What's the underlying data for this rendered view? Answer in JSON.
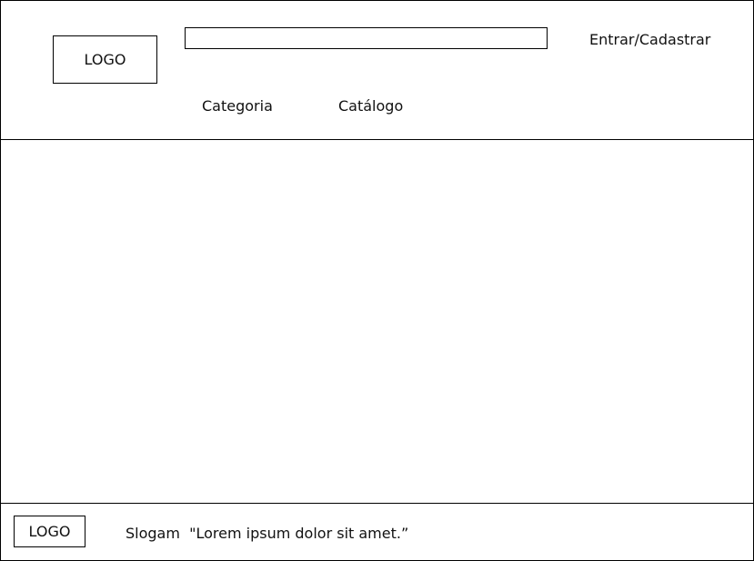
{
  "header": {
    "logo_text": "LOGO",
    "search": {
      "value": "",
      "placeholder": ""
    },
    "login_label": "Entrar/Cadastrar",
    "nav": {
      "categoria": "Categoria",
      "catalogo": "Catálogo"
    }
  },
  "footer": {
    "logo_text": "LOGO",
    "slogan": "Slogam  \"Lorem ipsum dolor sit amet.”"
  }
}
